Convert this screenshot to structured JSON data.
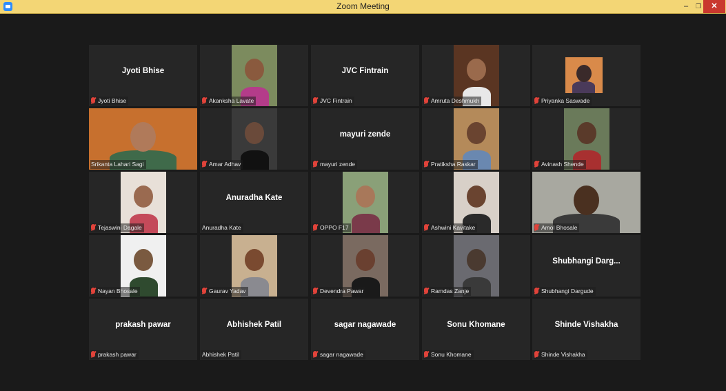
{
  "window": {
    "title": "Zoom Meeting",
    "min_icon": "–",
    "max_icon": "❐",
    "close_icon": "✕",
    "accent": "#f3d675",
    "close_color": "#c9382e"
  },
  "participants": [
    {
      "id": "p1",
      "name": "Jyoti Bhise",
      "display": "Jyoti Bhise",
      "muted": true,
      "video": false
    },
    {
      "id": "p2",
      "name": "Akanksha Lavate",
      "muted": true,
      "video": true
    },
    {
      "id": "p3",
      "name": "JVC Fintrain",
      "display": "JVC Fintrain",
      "muted": true,
      "video": false
    },
    {
      "id": "p4",
      "name": "Amruta Deshmukh",
      "muted": true,
      "video": true
    },
    {
      "id": "p5",
      "name": "Priyanka Saswade",
      "muted": true,
      "video": true
    },
    {
      "id": "p6",
      "name": "Srikanta Lahari Sagi",
      "muted": false,
      "video": true
    },
    {
      "id": "p7",
      "name": "Amar Adhav",
      "muted": true,
      "video": true
    },
    {
      "id": "p8",
      "name": "mayuri zende",
      "display": "mayuri zende",
      "muted": true,
      "video": false
    },
    {
      "id": "p9",
      "name": "Pratiksha Raskar",
      "muted": true,
      "video": true
    },
    {
      "id": "p10",
      "name": "Avinash Shende",
      "muted": true,
      "video": true
    },
    {
      "id": "p11",
      "name": "Tejaswini Dagale",
      "muted": true,
      "video": true
    },
    {
      "id": "p12",
      "name": "Anuradha Kate",
      "display": "Anuradha Kate",
      "muted": false,
      "video": false
    },
    {
      "id": "p13",
      "name": "OPPO F17",
      "muted": true,
      "video": true
    },
    {
      "id": "p14",
      "name": "Ashwini Kavitake",
      "muted": true,
      "video": true
    },
    {
      "id": "p15",
      "name": "Amol Bhosale",
      "muted": true,
      "video": true
    },
    {
      "id": "p16",
      "name": "Nayan Bhosale",
      "muted": true,
      "video": true
    },
    {
      "id": "p17",
      "name": "Gaurav Yadav",
      "muted": true,
      "video": true
    },
    {
      "id": "p18",
      "name": "Devendra Pawar",
      "muted": true,
      "video": true
    },
    {
      "id": "p19",
      "name": "Ramdas Zanje",
      "muted": true,
      "video": true
    },
    {
      "id": "p20",
      "name": "Shubhangi Dargude",
      "display": "Shubhangi  Darg...",
      "muted": true,
      "video": false
    },
    {
      "id": "p21",
      "name": "prakash pawar",
      "display": "prakash pawar",
      "muted": true,
      "video": false
    },
    {
      "id": "p22",
      "name": "Abhishek Patil",
      "display": "Abhishek Patil",
      "muted": false,
      "video": false
    },
    {
      "id": "p23",
      "name": "sagar nagawade",
      "display": "sagar nagawade",
      "muted": true,
      "video": false
    },
    {
      "id": "p24",
      "name": "Sonu Khomane",
      "display": "Sonu Khomane",
      "muted": true,
      "video": false
    },
    {
      "id": "p25",
      "name": "Shinde Vishakha",
      "display": "Shinde Vishakha",
      "muted": true,
      "video": false
    }
  ]
}
